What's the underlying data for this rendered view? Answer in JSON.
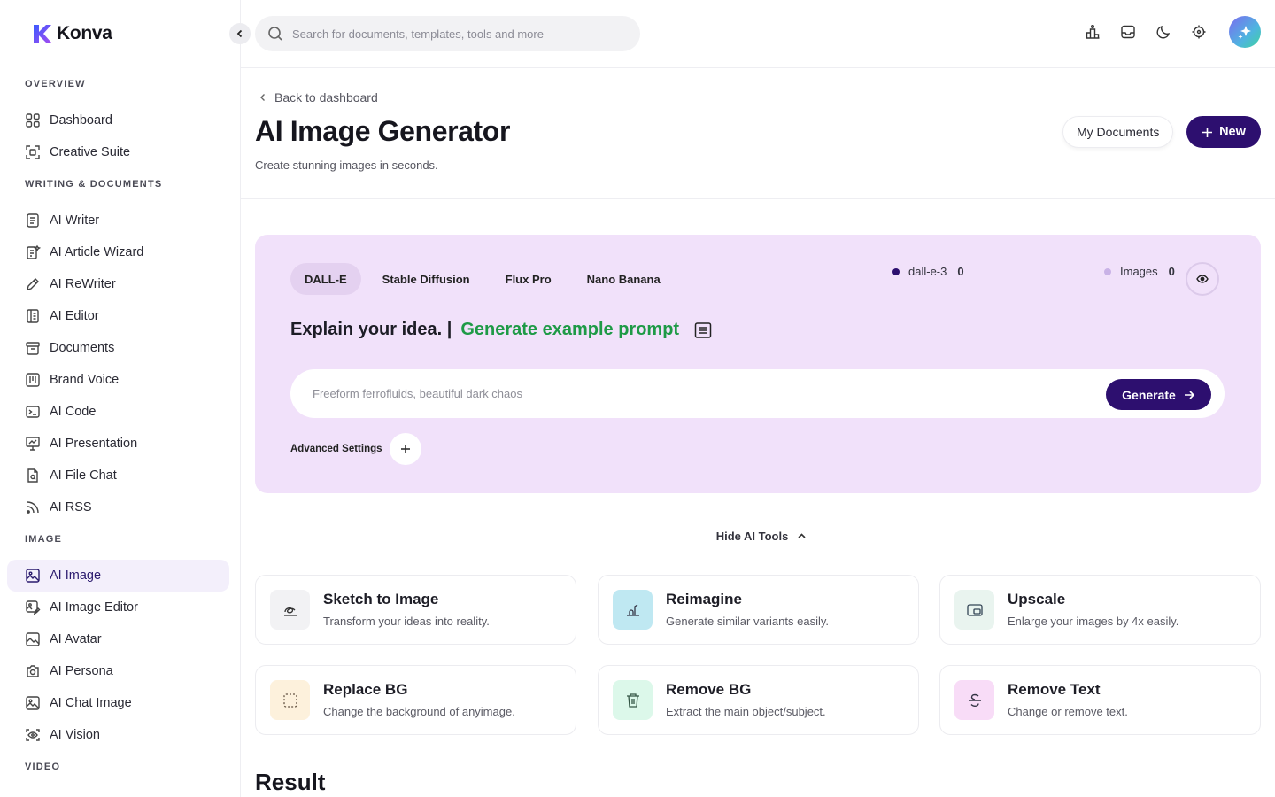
{
  "brand": {
    "name": "Konva"
  },
  "search": {
    "placeholder": "Search for documents, templates, tools and more"
  },
  "sidebar": {
    "sections": {
      "overview": "OVERVIEW",
      "writing": "WRITING & DOCUMENTS",
      "image": "IMAGE",
      "video": "VIDEO"
    },
    "items": [
      {
        "label": "Dashboard",
        "icon": "grid-icon"
      },
      {
        "label": "Creative Suite",
        "icon": "creative-suite-icon"
      },
      {
        "label": "AI Writer",
        "icon": "document-icon"
      },
      {
        "label": "AI Article Wizard",
        "icon": "article-wizard-icon"
      },
      {
        "label": "AI ReWriter",
        "icon": "pen-icon"
      },
      {
        "label": "AI Editor",
        "icon": "editor-icon"
      },
      {
        "label": "Documents",
        "icon": "archive-icon"
      },
      {
        "label": "Brand Voice",
        "icon": "brand-voice-icon"
      },
      {
        "label": "AI Code",
        "icon": "terminal-icon"
      },
      {
        "label": "AI Presentation",
        "icon": "presentation-icon"
      },
      {
        "label": "AI File Chat",
        "icon": "file-chat-icon"
      },
      {
        "label": "AI RSS",
        "icon": "rss-icon"
      },
      {
        "label": "AI Image",
        "icon": "image-icon",
        "active": true
      },
      {
        "label": "AI Image Editor",
        "icon": "image-editor-icon"
      },
      {
        "label": "AI Avatar",
        "icon": "avatar-image-icon"
      },
      {
        "label": "AI Persona",
        "icon": "persona-icon"
      },
      {
        "label": "AI Chat Image",
        "icon": "chat-image-icon"
      },
      {
        "label": "AI Vision",
        "icon": "vision-icon"
      }
    ]
  },
  "header": {
    "back": "Back to dashboard",
    "title": "AI Image Generator",
    "subtitle": "Create stunning images in seconds.",
    "my_documents": "My Documents",
    "new": "New"
  },
  "generator": {
    "tabs": [
      "DALL-E",
      "Stable Diffusion",
      "Flux Pro",
      "Nano Banana"
    ],
    "active_tab": "DALL-E",
    "stats": [
      {
        "label": "dall-e-3",
        "count": "0",
        "color": "#2d0f6f"
      },
      {
        "label": "Images",
        "count": "0",
        "color": "#c9b2e6"
      }
    ],
    "idea_label": "Explain your idea. |",
    "example_prompt": "Generate example prompt",
    "prompt_placeholder": "Freeform ferrofluids, beautiful dark chaos",
    "generate": "Generate",
    "advanced": "Advanced Settings"
  },
  "tools": {
    "toggle": "Hide AI Tools",
    "items": [
      {
        "title": "Sketch to Image",
        "desc": "Transform your ideas into reality.",
        "icon": "sketch-icon",
        "bg": "#f2f2f4"
      },
      {
        "title": "Reimagine",
        "desc": "Generate similar variants easily.",
        "icon": "reimagine-icon",
        "bg": "#bfe8f2"
      },
      {
        "title": "Upscale",
        "desc": "Enlarge your images by 4x easily.",
        "icon": "upscale-icon",
        "bg": "#e9f4ef"
      },
      {
        "title": "Replace BG",
        "desc": "Change the background of anyimage.",
        "icon": "replace-bg-icon",
        "bg": "#fdf1dc"
      },
      {
        "title": "Remove BG",
        "desc": "Extract the main object/subject.",
        "icon": "trash-icon",
        "bg": "#dcf8ea"
      },
      {
        "title": "Remove Text",
        "desc": "Change or remove text.",
        "icon": "strikethrough-icon",
        "bg": "#f8dcf7"
      }
    ]
  },
  "result": {
    "title": "Result"
  }
}
